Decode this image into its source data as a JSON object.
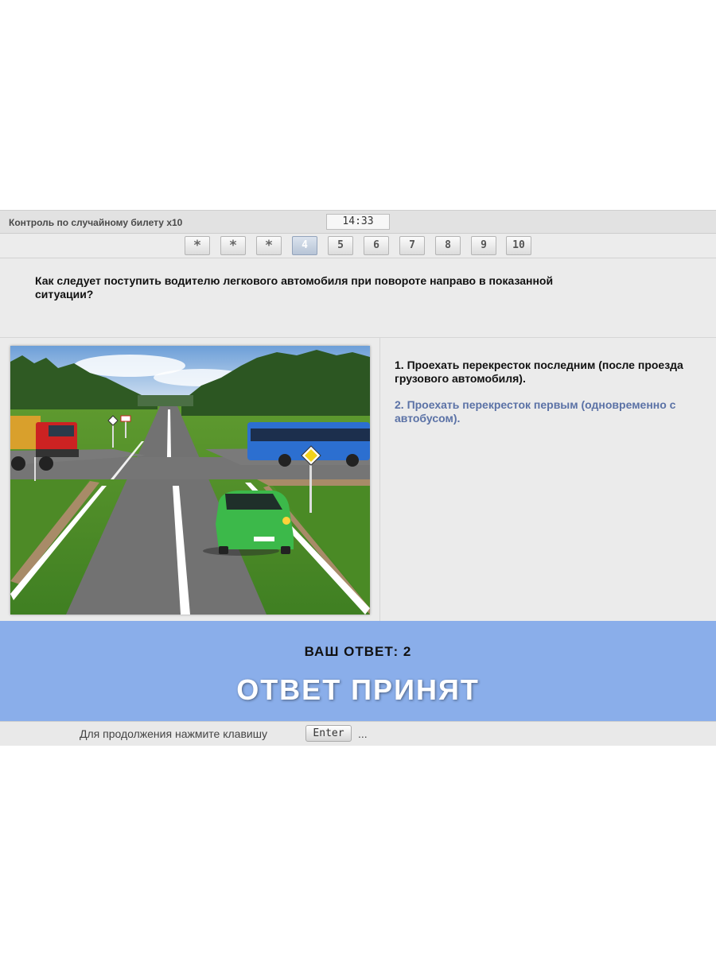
{
  "header": {
    "title": "Контроль по случайному билету x10",
    "timer": "14:33"
  },
  "question_nav": [
    {
      "label": "*",
      "state": "done"
    },
    {
      "label": "*",
      "state": "done"
    },
    {
      "label": "*",
      "state": "done"
    },
    {
      "label": "4",
      "state": "current"
    },
    {
      "label": "5",
      "state": "pending"
    },
    {
      "label": "6",
      "state": "pending"
    },
    {
      "label": "7",
      "state": "pending"
    },
    {
      "label": "8",
      "state": "pending"
    },
    {
      "label": "9",
      "state": "pending"
    },
    {
      "label": "10",
      "state": "pending"
    }
  ],
  "question": {
    "text": "Как следует поступить водителю легкового автомобиля при повороте направо в показанной ситуации?"
  },
  "answers": [
    {
      "text": "1.  Проехать перекресток последним (после проезда грузового автомобиля)."
    },
    {
      "text": "2.  Проехать перекресток первым (одновременно с автобусом)."
    }
  ],
  "result": {
    "your_answer": "ВАШ  ОТВЕТ:  2",
    "status": "ОТВЕТ  ПРИНЯТ"
  },
  "footer": {
    "prompt": "Для продолжения нажмите клавишу",
    "key": "Enter",
    "ellipsis": "..."
  },
  "colors": {
    "result_band": "#8aaeea",
    "selected_answer": "#5b72a6",
    "current_question": "#b7c4d6"
  }
}
